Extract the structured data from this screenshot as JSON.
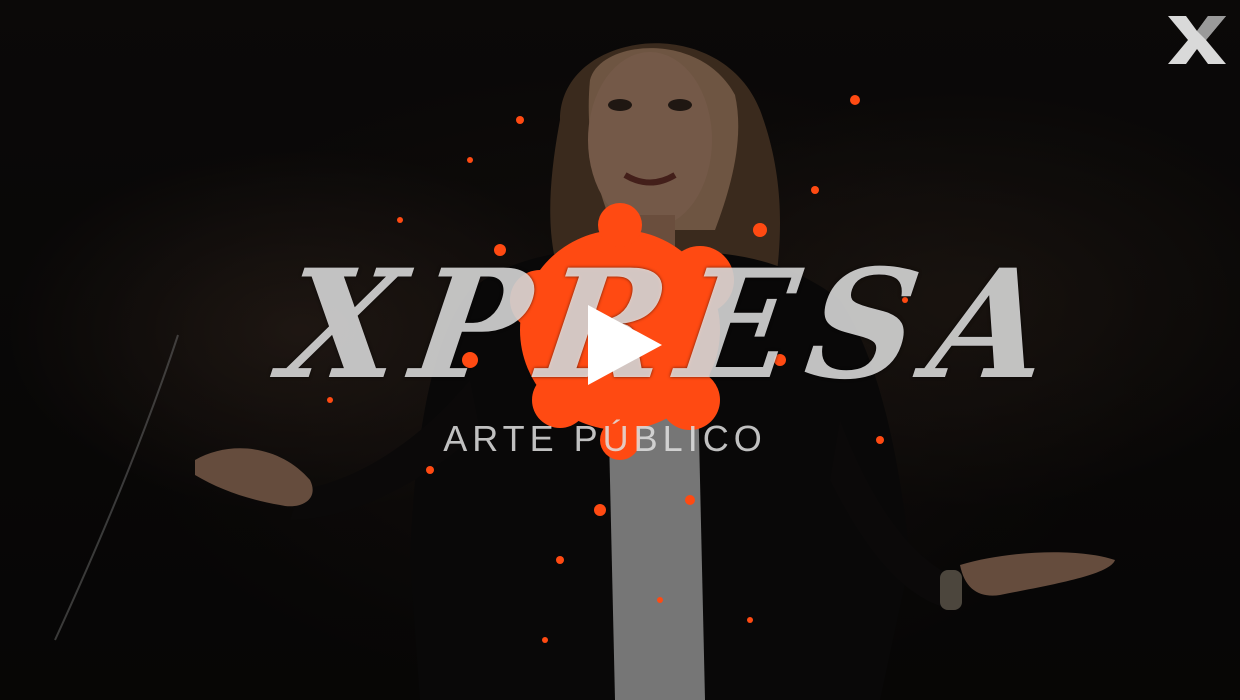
{
  "video": {
    "brand_title": "XPRESA",
    "brand_subtitle": "ARTE PÚBLICO"
  },
  "icons": {
    "play": "play-icon",
    "logo": "x-logo-icon"
  },
  "colors": {
    "accent": "#ff4a12",
    "play_triangle": "#ffffff",
    "logo": "#d9d9d9"
  }
}
